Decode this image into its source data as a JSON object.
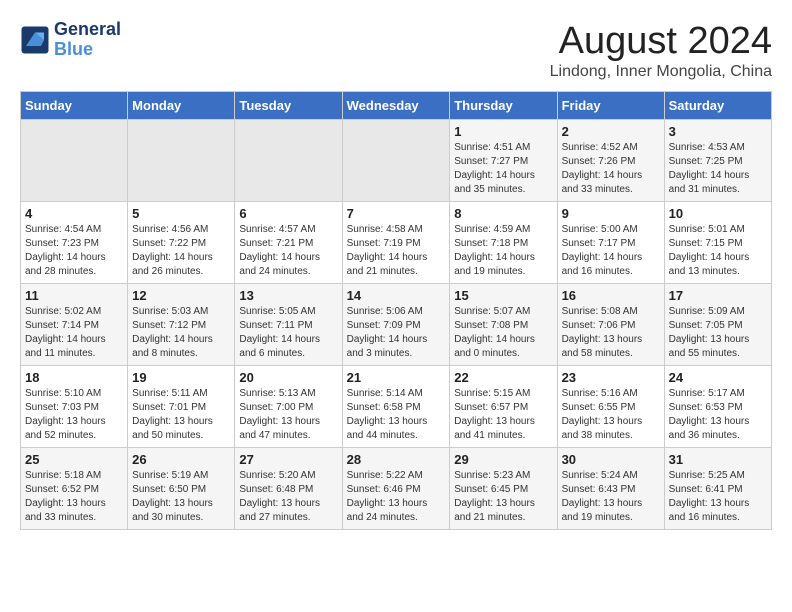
{
  "header": {
    "logo_line1": "General",
    "logo_line2": "Blue",
    "title": "August 2024",
    "subtitle": "Lindong, Inner Mongolia, China"
  },
  "calendar": {
    "days_of_week": [
      "Sunday",
      "Monday",
      "Tuesday",
      "Wednesday",
      "Thursday",
      "Friday",
      "Saturday"
    ],
    "weeks": [
      [
        {
          "day": "",
          "info": ""
        },
        {
          "day": "",
          "info": ""
        },
        {
          "day": "",
          "info": ""
        },
        {
          "day": "",
          "info": ""
        },
        {
          "day": "1",
          "info": "Sunrise: 4:51 AM\nSunset: 7:27 PM\nDaylight: 14 hours\nand 35 minutes."
        },
        {
          "day": "2",
          "info": "Sunrise: 4:52 AM\nSunset: 7:26 PM\nDaylight: 14 hours\nand 33 minutes."
        },
        {
          "day": "3",
          "info": "Sunrise: 4:53 AM\nSunset: 7:25 PM\nDaylight: 14 hours\nand 31 minutes."
        }
      ],
      [
        {
          "day": "4",
          "info": "Sunrise: 4:54 AM\nSunset: 7:23 PM\nDaylight: 14 hours\nand 28 minutes."
        },
        {
          "day": "5",
          "info": "Sunrise: 4:56 AM\nSunset: 7:22 PM\nDaylight: 14 hours\nand 26 minutes."
        },
        {
          "day": "6",
          "info": "Sunrise: 4:57 AM\nSunset: 7:21 PM\nDaylight: 14 hours\nand 24 minutes."
        },
        {
          "day": "7",
          "info": "Sunrise: 4:58 AM\nSunset: 7:19 PM\nDaylight: 14 hours\nand 21 minutes."
        },
        {
          "day": "8",
          "info": "Sunrise: 4:59 AM\nSunset: 7:18 PM\nDaylight: 14 hours\nand 19 minutes."
        },
        {
          "day": "9",
          "info": "Sunrise: 5:00 AM\nSunset: 7:17 PM\nDaylight: 14 hours\nand 16 minutes."
        },
        {
          "day": "10",
          "info": "Sunrise: 5:01 AM\nSunset: 7:15 PM\nDaylight: 14 hours\nand 13 minutes."
        }
      ],
      [
        {
          "day": "11",
          "info": "Sunrise: 5:02 AM\nSunset: 7:14 PM\nDaylight: 14 hours\nand 11 minutes."
        },
        {
          "day": "12",
          "info": "Sunrise: 5:03 AM\nSunset: 7:12 PM\nDaylight: 14 hours\nand 8 minutes."
        },
        {
          "day": "13",
          "info": "Sunrise: 5:05 AM\nSunset: 7:11 PM\nDaylight: 14 hours\nand 6 minutes."
        },
        {
          "day": "14",
          "info": "Sunrise: 5:06 AM\nSunset: 7:09 PM\nDaylight: 14 hours\nand 3 minutes."
        },
        {
          "day": "15",
          "info": "Sunrise: 5:07 AM\nSunset: 7:08 PM\nDaylight: 14 hours\nand 0 minutes."
        },
        {
          "day": "16",
          "info": "Sunrise: 5:08 AM\nSunset: 7:06 PM\nDaylight: 13 hours\nand 58 minutes."
        },
        {
          "day": "17",
          "info": "Sunrise: 5:09 AM\nSunset: 7:05 PM\nDaylight: 13 hours\nand 55 minutes."
        }
      ],
      [
        {
          "day": "18",
          "info": "Sunrise: 5:10 AM\nSunset: 7:03 PM\nDaylight: 13 hours\nand 52 minutes."
        },
        {
          "day": "19",
          "info": "Sunrise: 5:11 AM\nSunset: 7:01 PM\nDaylight: 13 hours\nand 50 minutes."
        },
        {
          "day": "20",
          "info": "Sunrise: 5:13 AM\nSunset: 7:00 PM\nDaylight: 13 hours\nand 47 minutes."
        },
        {
          "day": "21",
          "info": "Sunrise: 5:14 AM\nSunset: 6:58 PM\nDaylight: 13 hours\nand 44 minutes."
        },
        {
          "day": "22",
          "info": "Sunrise: 5:15 AM\nSunset: 6:57 PM\nDaylight: 13 hours\nand 41 minutes."
        },
        {
          "day": "23",
          "info": "Sunrise: 5:16 AM\nSunset: 6:55 PM\nDaylight: 13 hours\nand 38 minutes."
        },
        {
          "day": "24",
          "info": "Sunrise: 5:17 AM\nSunset: 6:53 PM\nDaylight: 13 hours\nand 36 minutes."
        }
      ],
      [
        {
          "day": "25",
          "info": "Sunrise: 5:18 AM\nSunset: 6:52 PM\nDaylight: 13 hours\nand 33 minutes."
        },
        {
          "day": "26",
          "info": "Sunrise: 5:19 AM\nSunset: 6:50 PM\nDaylight: 13 hours\nand 30 minutes."
        },
        {
          "day": "27",
          "info": "Sunrise: 5:20 AM\nSunset: 6:48 PM\nDaylight: 13 hours\nand 27 minutes."
        },
        {
          "day": "28",
          "info": "Sunrise: 5:22 AM\nSunset: 6:46 PM\nDaylight: 13 hours\nand 24 minutes."
        },
        {
          "day": "29",
          "info": "Sunrise: 5:23 AM\nSunset: 6:45 PM\nDaylight: 13 hours\nand 21 minutes."
        },
        {
          "day": "30",
          "info": "Sunrise: 5:24 AM\nSunset: 6:43 PM\nDaylight: 13 hours\nand 19 minutes."
        },
        {
          "day": "31",
          "info": "Sunrise: 5:25 AM\nSunset: 6:41 PM\nDaylight: 13 hours\nand 16 minutes."
        }
      ]
    ]
  }
}
